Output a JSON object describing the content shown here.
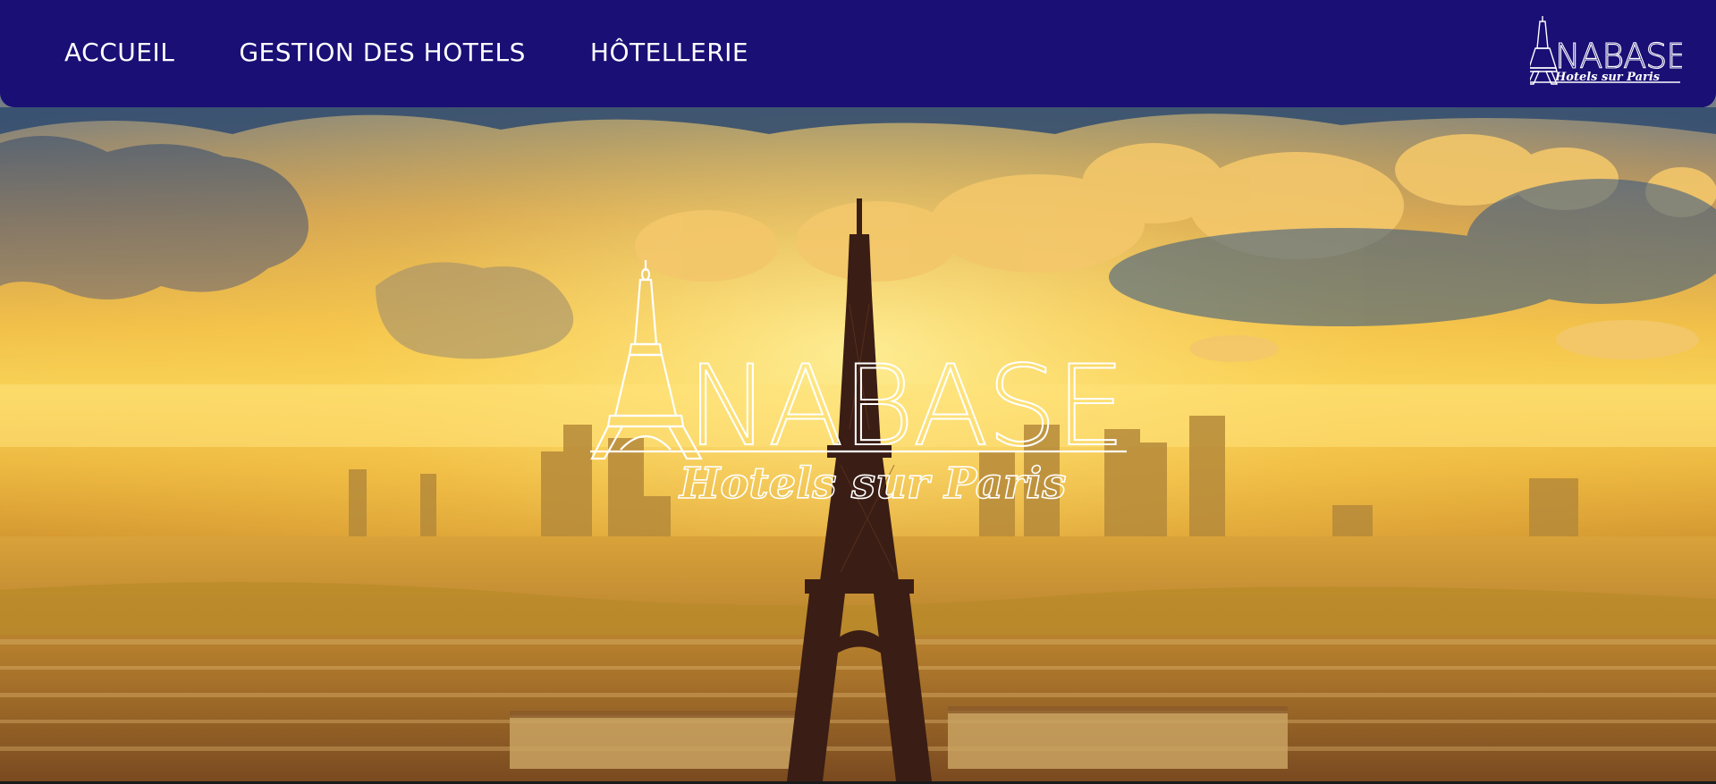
{
  "nav": {
    "links": [
      {
        "label": "ACCUEIL"
      },
      {
        "label": "GESTION DES HOTELS"
      },
      {
        "label": "HÔTELLERIE"
      }
    ],
    "logo": {
      "title": "NABASE",
      "subtitle": "Hotels sur Paris"
    }
  },
  "hero": {
    "logo": {
      "title": "NABASE",
      "subtitle": "Hotels sur Paris"
    }
  },
  "colors": {
    "nav_background": "#1a0f75",
    "nav_text": "#ffffff",
    "logo_stroke": "#ffffff"
  }
}
